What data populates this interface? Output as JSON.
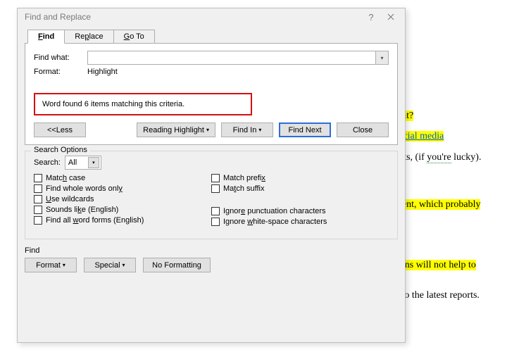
{
  "dialog": {
    "title": "Find and Replace",
    "help": "?",
    "tabs": {
      "find": "Find",
      "replace": "Replace",
      "goto": "Go To"
    },
    "find_what_label": "Find what:",
    "format_label": "Format:",
    "format_value": "Highlight",
    "status": "Word found 6 items matching this criteria.",
    "buttons": {
      "less": "<< Less",
      "reading_highlight": "Reading Highlight",
      "find_in": "Find In",
      "find_next": "Find Next",
      "close": "Close"
    },
    "search_options_title": "Search Options",
    "search_label": "Search:",
    "search_value": "All",
    "checks": {
      "match_case": "Match case",
      "whole_words": "Find whole words only",
      "wildcards": "Use wildcards",
      "sounds_like": "Sounds like (English)",
      "all_forms": "Find all word forms (English)",
      "match_prefix": "Match prefix",
      "match_suffix": "Match suffix",
      "ignore_punct": "Ignore punctuation characters",
      "ignore_ws": "Ignore white-space characters"
    },
    "find_section": {
      "title": "Find",
      "format": "Format",
      "special": "Special",
      "no_formatting": "No Formatting"
    }
  },
  "doc": {
    "l1": "tent?",
    "l2": "social media",
    "l3a": "ents, (if ",
    "l3b": "you're",
    "l3c": " lucky).",
    "l4": "ntent, which probably",
    "l5": "tions will not help to",
    "l6": "g to the latest reports."
  }
}
